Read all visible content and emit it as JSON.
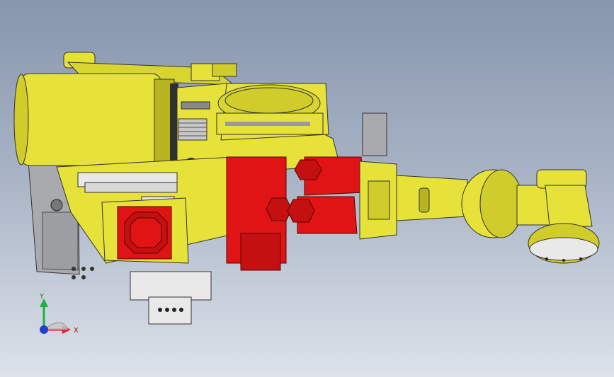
{
  "viewport": {
    "background_top": "#8796ad",
    "background_bottom": "#dde2ea"
  },
  "model": {
    "yellow": "#e6e23a",
    "yellow_dark": "#b8b41f",
    "red": "#e01414",
    "red_dark": "#9e0a0a",
    "gray": "#a9aaad",
    "white": "#e9e9ea"
  },
  "triad": {
    "x_label": "X",
    "y_label": "Y",
    "x_color": "#e02020",
    "y_color": "#20b040",
    "z_color": "#2040d0"
  }
}
